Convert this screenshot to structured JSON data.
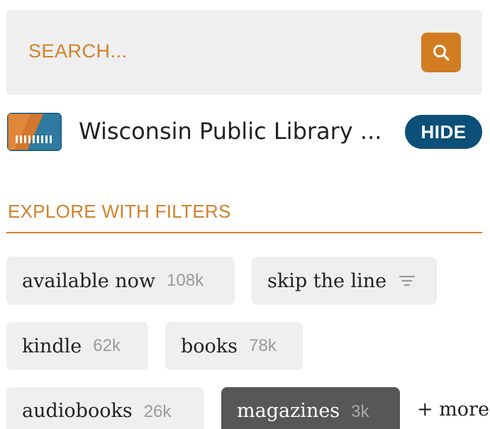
{
  "search": {
    "placeholder": "SEARCH...",
    "button_icon": "search-icon",
    "accent_color": "#d27c22"
  },
  "library": {
    "name": "Wisconsin Public Library ...",
    "logo_icon": "library-logo",
    "hide_label": "HIDE",
    "hide_color": "#0c4f78"
  },
  "filters": {
    "heading": "EXPLORE WITH FILTERS",
    "chips": [
      {
        "label": "available now",
        "count": "108k",
        "selected": false
      },
      {
        "label": "skip the line",
        "count": "",
        "icon": "filter-lines-icon",
        "selected": false
      },
      {
        "label": "kindle",
        "count": "62k",
        "selected": false
      },
      {
        "label": "books",
        "count": "78k",
        "selected": false
      },
      {
        "label": "audiobooks",
        "count": "26k",
        "selected": false
      },
      {
        "label": "magazines",
        "count": "3k",
        "selected": true
      }
    ],
    "more_label": "+ more"
  }
}
